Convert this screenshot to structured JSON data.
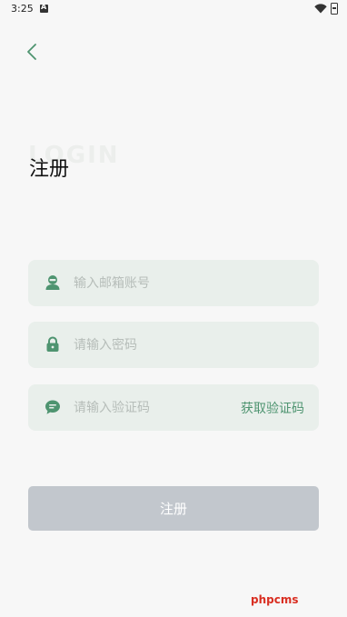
{
  "status_bar": {
    "time": "3:25"
  },
  "header": {
    "watermark": "LOGIN",
    "title": "注册"
  },
  "form": {
    "email_placeholder": "输入邮箱账号",
    "password_placeholder": "请输入密码",
    "code_placeholder": "请输入验证码",
    "get_code_label": "获取验证码",
    "submit_label": "注册"
  },
  "watermark_text": "phpcms",
  "colors": {
    "accent": "#4e9470",
    "field_bg": "#e9efeb",
    "button_disabled": "#c2c7cd",
    "watermark": "#d92e21"
  },
  "icons": [
    "back-chevron-icon",
    "user-icon",
    "lock-icon",
    "chat-bubble-icon"
  ]
}
